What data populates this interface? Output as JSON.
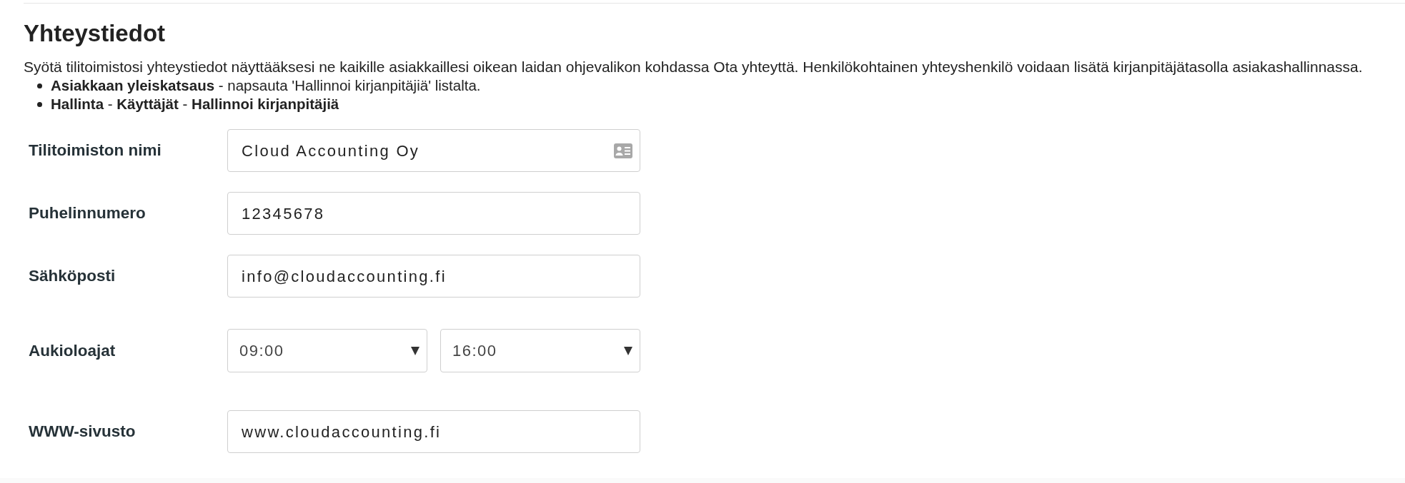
{
  "section": {
    "title": "Yhteystiedot",
    "description": "Syötä tilitoimistosi yhteystiedot näyttääksesi ne kaikille asiakkaillesi oikean laidan ohjevalikon kohdassa Ota yhteyttä. Henkilökohtainen yhteyshenkilö voidaan lisätä kirjanpitäjätasolla asiakashallinnassa.",
    "steps": [
      "**Asiakkaan yleiskatsaus** - napsauta 'Hallinnoi kirjanpitäjiä' listalta.",
      "**Hallinta** - **Käyttäjät** - **Hallinnoi kirjanpitäjiä**"
    ]
  },
  "fields": [
    {
      "kind": "card",
      "label": "Tilitoimiston nimi",
      "value": "Cloud Accounting Oy"
    },
    {
      "kind": "text",
      "label": "Puhelinnumero",
      "value": "12345678"
    },
    {
      "kind": "text",
      "label": "Sähköposti",
      "value": "info@cloudaccounting.fi"
    },
    {
      "kind": "time_range",
      "label": "Aukioloajat",
      "from": "09:00",
      "to": "16:00"
    },
    {
      "kind": "text",
      "label": "WWW-sivusto",
      "value": "www.cloudaccounting.fi"
    }
  ]
}
